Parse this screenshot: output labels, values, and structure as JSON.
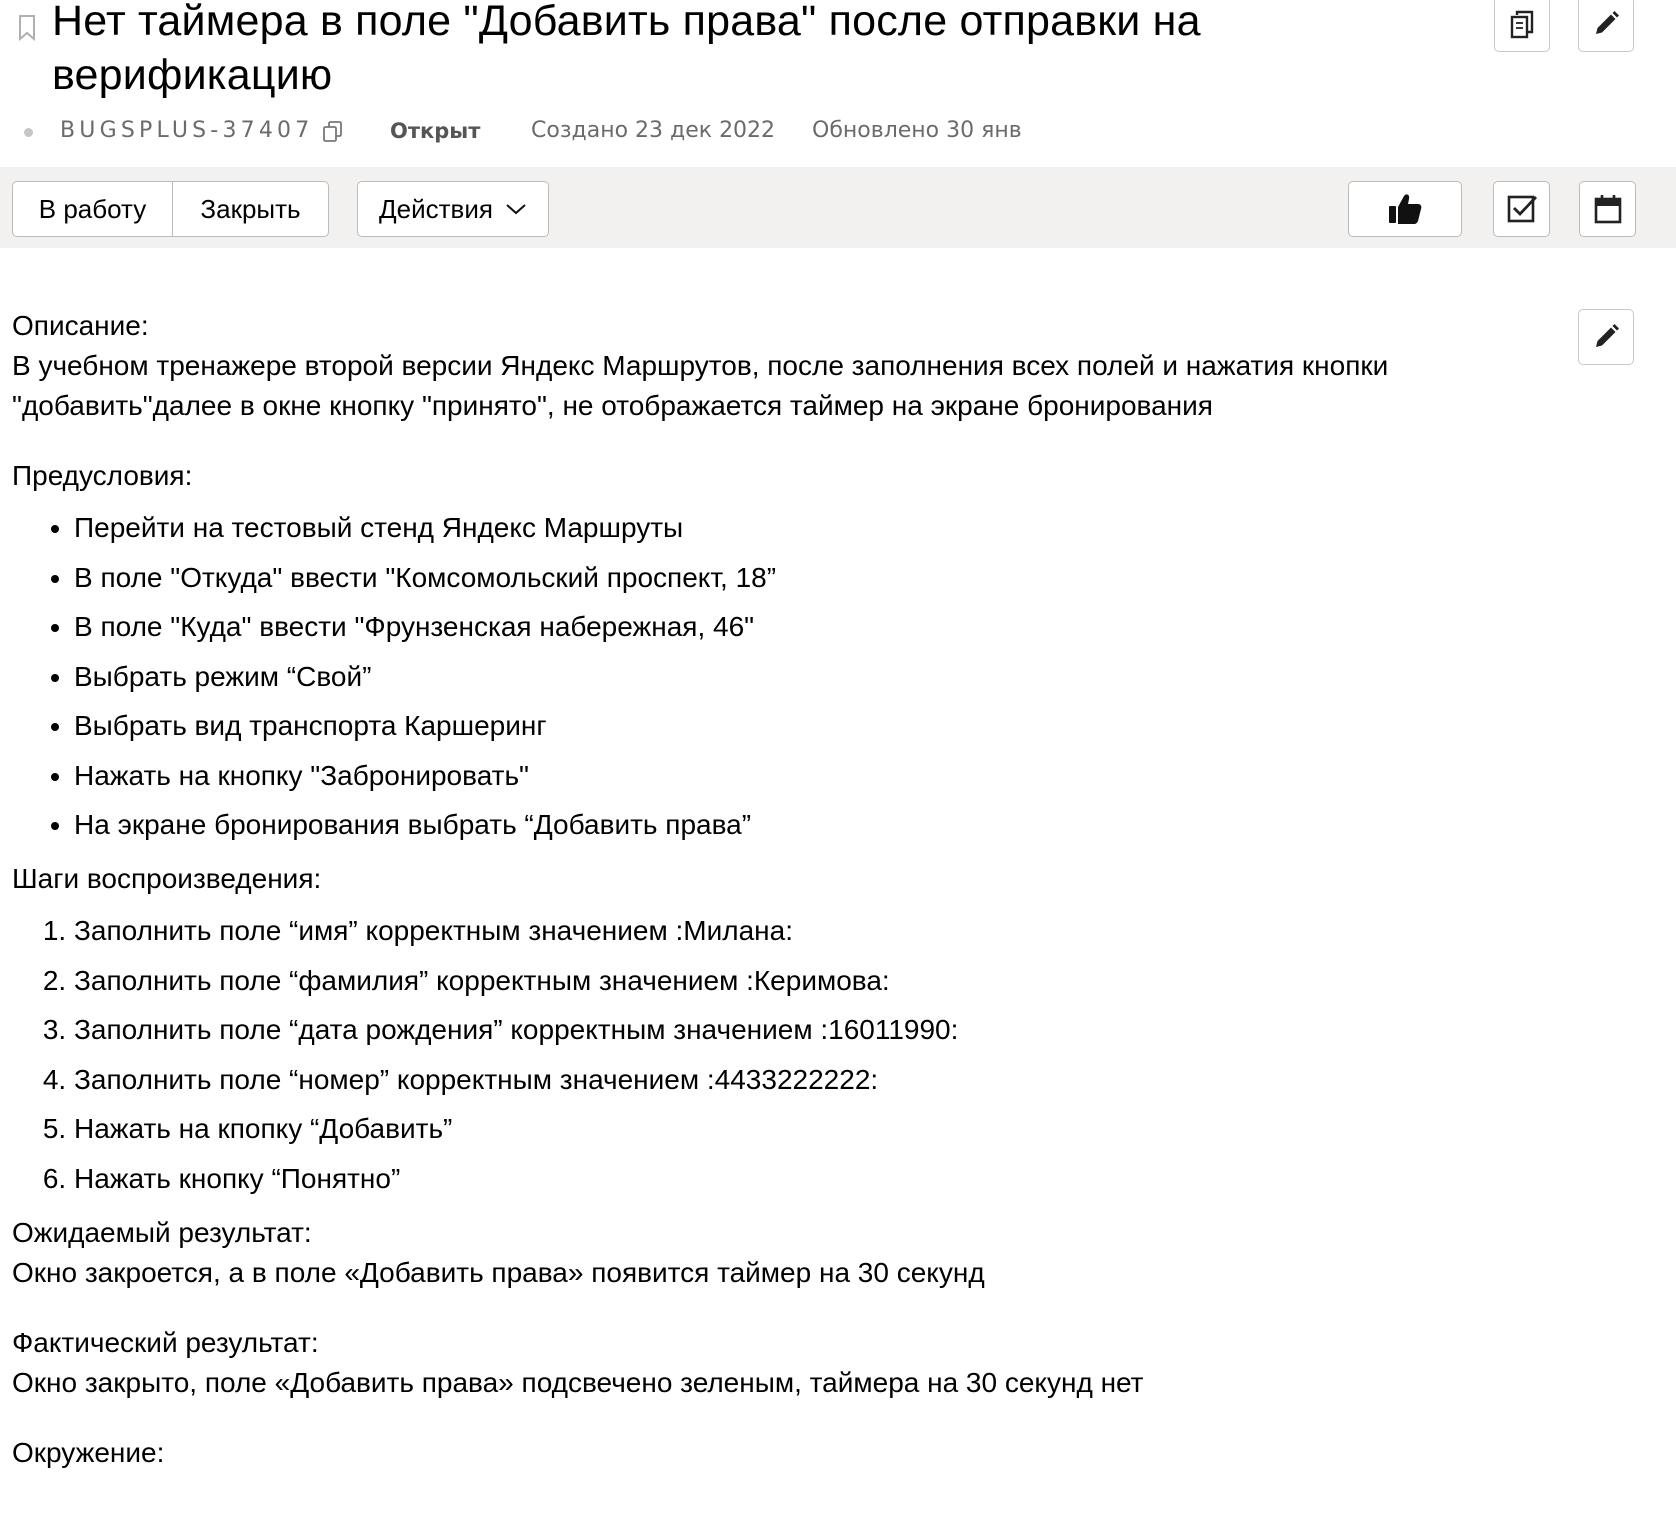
{
  "issue": {
    "title": "Нет таймера в поле \"Добавить права\" после отправки на верификацию",
    "key": "BUGSPLUS-37407",
    "status": "Открыт",
    "created": "Создано 23 дек 2022",
    "updated": "Обновлено 30 янв"
  },
  "toolbar": {
    "work_label": "В работу",
    "close_label": "Закрыть",
    "actions_label": "Действия"
  },
  "icons": {
    "bookmark": "bookmark-icon",
    "copy_link": "copy-icon",
    "edit": "pencil-icon",
    "copy_key": "copy-icon",
    "like": "thumbs-up-icon",
    "checklist": "checkbox-icon",
    "calendar": "calendar-icon",
    "dropdown": "chevron-down-icon"
  },
  "description": {
    "label": "Описание:",
    "text": "В учебном тренажере второй версии Яндекс Маршрутов, после заполнения всех полей и нажатия кнопки \"добавить\"далее в окне кнопку \"принято\", не отображается таймер на экране бронирования",
    "preconditions_label": "Предусловия:",
    "preconditions": [
      "Перейти на тестовый стенд Яндекс Маршруты",
      "В поле \"Откуда\" ввести \"Комсомольский проспект, 18”",
      "В поле \"Куда\" ввести \"Фрунзенская набережная, 46\"",
      "Выбрать режим “Свой”",
      "Выбрать вид транспорта Каршеринг",
      "Нажать на кнопку \"Забронировать\"",
      "На экране бронирования выбрать “Добавить права”"
    ],
    "steps_label": "Шаги воспроизведения:",
    "steps": [
      "Заполнить поле “имя” корректным значением :Милана:",
      "Заполнить поле “фамилия” корректным значением :Керимова:",
      "Заполнить поле “дата рождения” корректным значением :16011990:",
      "Заполнить поле “номер” корректным значением :4433222222:",
      "Нажать на кпопку “Добавить”",
      "Нажать кнопку “Понятно”"
    ],
    "expected_label": "Ожидаемый результат:",
    "expected": "Окно закроется, а в поле «Добавить права» появится таймер на 30 секунд",
    "actual_label": "Фактический результат:",
    "actual": "Окно закрыто, поле «Добавить права» подсвечено зеленым, таймера на 30 секунд нет",
    "environment_label": "Окружение:"
  }
}
